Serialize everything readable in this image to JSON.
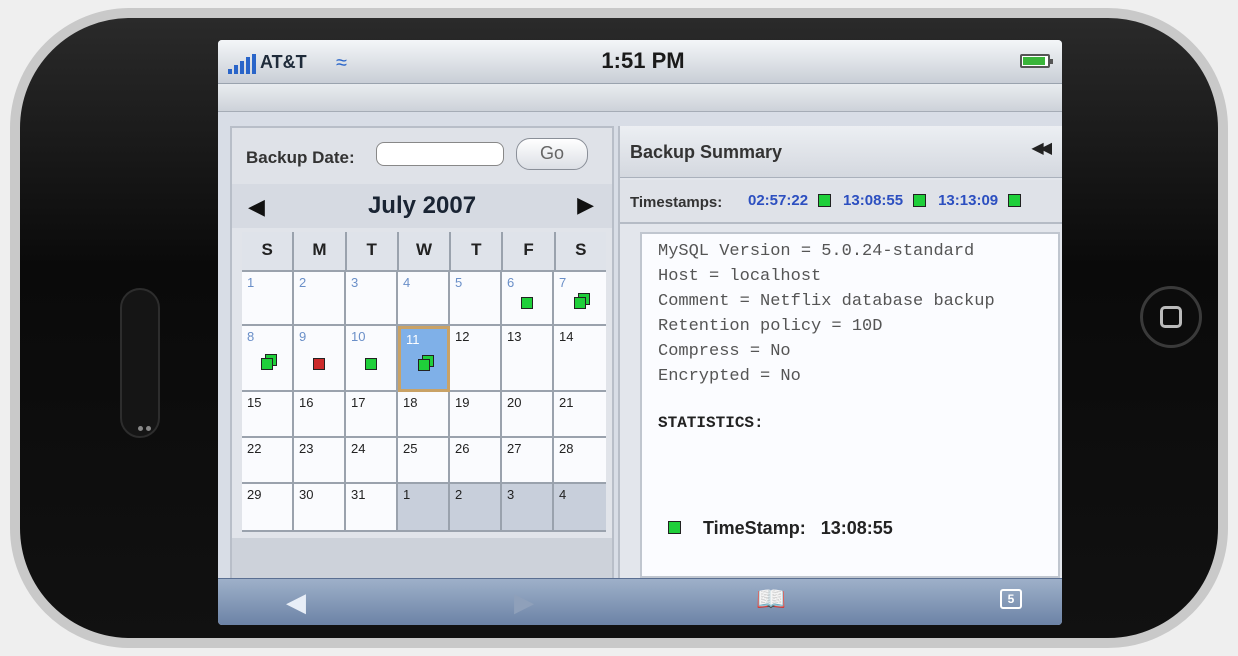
{
  "status_bar": {
    "carrier": "AT&T",
    "time": "1:51 PM"
  },
  "calendar": {
    "backup_date_label": "Backup Date:",
    "date_value": "",
    "go_label": "Go",
    "month_title": "July 2007",
    "weekdays": [
      "S",
      "M",
      "T",
      "W",
      "T",
      "F",
      "S"
    ],
    "days": [
      {
        "n": "1",
        "state": "past",
        "marker": ""
      },
      {
        "n": "2",
        "state": "past",
        "marker": ""
      },
      {
        "n": "3",
        "state": "past",
        "marker": ""
      },
      {
        "n": "4",
        "state": "past",
        "marker": ""
      },
      {
        "n": "5",
        "state": "past",
        "marker": ""
      },
      {
        "n": "6",
        "state": "past",
        "marker": "green"
      },
      {
        "n": "7",
        "state": "past",
        "marker": "stack"
      },
      {
        "n": "8",
        "state": "past",
        "marker": "stack"
      },
      {
        "n": "9",
        "state": "past",
        "marker": "red"
      },
      {
        "n": "10",
        "state": "past",
        "marker": "green"
      },
      {
        "n": "11",
        "state": "selected",
        "marker": "stack"
      },
      {
        "n": "12",
        "state": "",
        "marker": ""
      },
      {
        "n": "13",
        "state": "",
        "marker": ""
      },
      {
        "n": "14",
        "state": "",
        "marker": ""
      },
      {
        "n": "15",
        "state": "",
        "marker": ""
      },
      {
        "n": "16",
        "state": "",
        "marker": ""
      },
      {
        "n": "17",
        "state": "",
        "marker": ""
      },
      {
        "n": "18",
        "state": "",
        "marker": ""
      },
      {
        "n": "19",
        "state": "",
        "marker": ""
      },
      {
        "n": "20",
        "state": "",
        "marker": ""
      },
      {
        "n": "21",
        "state": "",
        "marker": ""
      },
      {
        "n": "22",
        "state": "",
        "marker": ""
      },
      {
        "n": "23",
        "state": "",
        "marker": ""
      },
      {
        "n": "24",
        "state": "",
        "marker": ""
      },
      {
        "n": "25",
        "state": "",
        "marker": ""
      },
      {
        "n": "26",
        "state": "",
        "marker": ""
      },
      {
        "n": "27",
        "state": "",
        "marker": ""
      },
      {
        "n": "28",
        "state": "",
        "marker": ""
      },
      {
        "n": "29",
        "state": "",
        "marker": ""
      },
      {
        "n": "30",
        "state": "",
        "marker": ""
      },
      {
        "n": "31",
        "state": "",
        "marker": ""
      },
      {
        "n": "1",
        "state": "other",
        "marker": ""
      },
      {
        "n": "2",
        "state": "other",
        "marker": ""
      },
      {
        "n": "3",
        "state": "other",
        "marker": ""
      },
      {
        "n": "4",
        "state": "other",
        "marker": ""
      }
    ]
  },
  "summary": {
    "title": "Backup Summary",
    "timestamps_label": "Timestamps:",
    "timestamps": [
      "02:57:22",
      "13:08:55",
      "13:13:09"
    ],
    "details": [
      "MySQL Version = 5.0.24-standard",
      "Host = localhost",
      "Comment = Netflix database backup",
      "Retention policy = 10D",
      "Compress = No",
      "Encrypted = No"
    ],
    "statistics_heading": "STATISTICS:",
    "timestamp_line_label": "TimeStamp:",
    "timestamp_line_value": "13:08:55"
  },
  "toolbar": {
    "pages_count": "5"
  },
  "colors": {
    "marker_green": "#1fcf3a",
    "marker_red": "#cc2b2b",
    "timestamp_link": "#2c4fc0",
    "selected_day": "#7fb0e8"
  }
}
